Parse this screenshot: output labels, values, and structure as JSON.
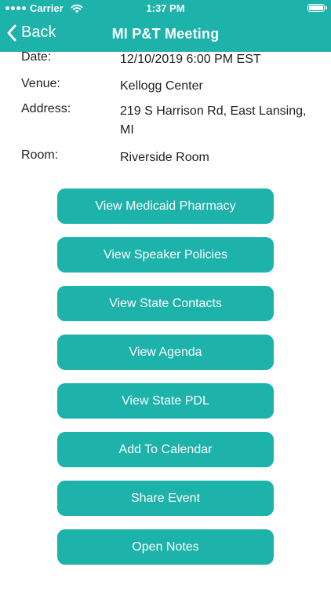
{
  "status_bar": {
    "carrier": "Carrier",
    "time": "1:37 PM",
    "battery_level": 1.0
  },
  "nav": {
    "back_label": "Back",
    "title": "MI P&T Meeting"
  },
  "details": [
    {
      "label": "Date:",
      "value": "12/10/2019 6:00 PM EST"
    },
    {
      "label": "Venue:",
      "value": "Kellogg Center"
    },
    {
      "label": "Address:",
      "value": "219 S Harrison Rd, East Lansing, MI"
    },
    {
      "label": "Room:",
      "value": "Riverside Room"
    }
  ],
  "buttons": [
    {
      "label": "View Medicaid Pharmacy"
    },
    {
      "label": "View Speaker Policies"
    },
    {
      "label": "View State Contacts"
    },
    {
      "label": "View Agenda"
    },
    {
      "label": "View State PDL"
    },
    {
      "label": "Add To Calendar"
    },
    {
      "label": "Share Event"
    },
    {
      "label": "Open Notes"
    }
  ],
  "colors": {
    "accent": "#1db2aa",
    "text": "#1f1f1f",
    "background": "#ffffff"
  },
  "icons": {
    "back": "chevron-left-icon",
    "wifi": "wifi-icon",
    "signal": "signal-icon",
    "battery": "battery-icon"
  }
}
